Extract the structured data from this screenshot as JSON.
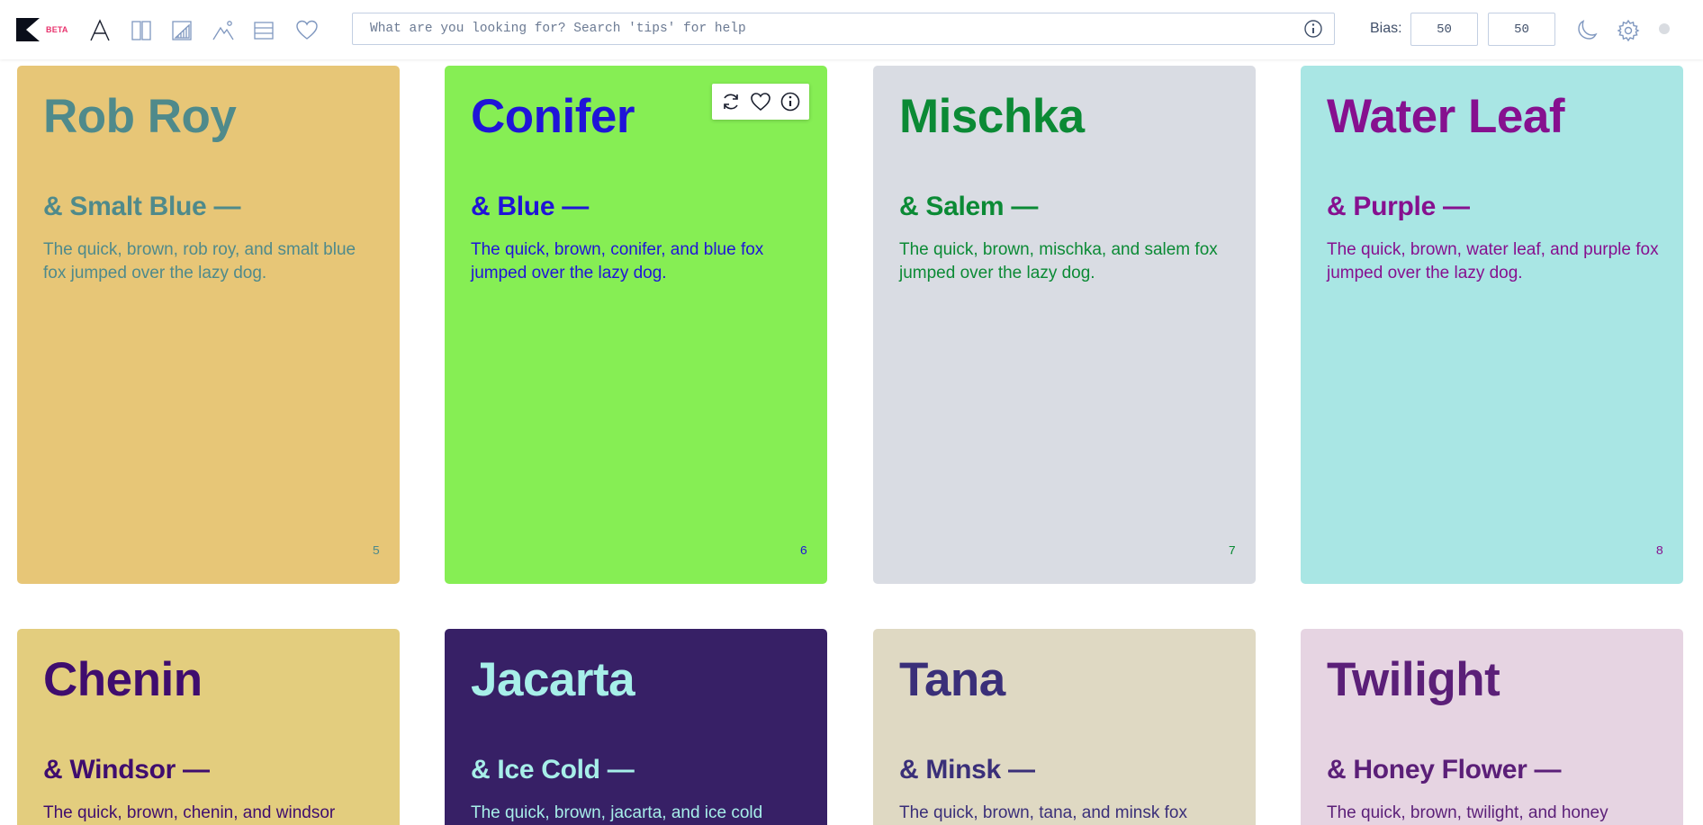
{
  "app": {
    "beta_label": "BETA",
    "toolbar_icons": [
      "typeface-icon",
      "split-columns-icon",
      "chart-panel-icon",
      "image-mountain-icon",
      "list-rows-icon",
      "heart-icon"
    ]
  },
  "search": {
    "placeholder": "What are you looking for? Search 'tips' for help",
    "value": ""
  },
  "bias": {
    "label": "Bias:",
    "value_1": "50",
    "value_2": "50"
  },
  "colors": {
    "accent": "#e8336d",
    "icon": "#7f97bf"
  },
  "cards": [
    {
      "number": "5",
      "name": "Rob Roy",
      "pair": "& Smalt Blue —",
      "sentence": "The quick, brown, rob roy, and smalt blue fox jumped over the lazy dog.",
      "bg": "#e7c677",
      "fg": "#4f8a8b"
    },
    {
      "number": "6",
      "name": "Conifer",
      "pair": "& Blue —",
      "sentence": "The quick, brown, conifer, and blue fox jumped over the lazy dog.",
      "bg": "#86ee54",
      "fg": "#1f14d8",
      "hover_tools": [
        "refresh-icon",
        "heart-icon",
        "info-icon"
      ]
    },
    {
      "number": "7",
      "name": "Mischka",
      "pair": "& Salem —",
      "sentence": "The quick, brown, mischka, and salem fox jumped over the lazy dog.",
      "bg": "#d9dce3",
      "fg": "#0b8a35"
    },
    {
      "number": "8",
      "name": "Water Leaf",
      "pair": "& Purple —",
      "sentence": "The quick, brown, water leaf, and purple fox jumped over the lazy dog.",
      "bg": "#a9e6e4",
      "fg": "#86108f"
    },
    {
      "number": "",
      "name": "Chenin",
      "pair": "& Windsor —",
      "sentence": "The quick, brown, chenin, and windsor",
      "bg": "#e3cd7e",
      "fg": "#3f0d6e"
    },
    {
      "number": "",
      "name": "Jacarta",
      "pair": "& Ice Cold —",
      "sentence": "The quick, brown, jacarta, and ice cold",
      "bg": "#372066",
      "fg": "#a7efe9"
    },
    {
      "number": "",
      "name": "Tana",
      "pair": "& Minsk —",
      "sentence": "The quick, brown, tana, and minsk fox",
      "bg": "#dfd9c3",
      "fg": "#3a2f79"
    },
    {
      "number": "",
      "name": "Twilight",
      "pair": "& Honey Flower —",
      "sentence": "The quick, brown, twilight, and honey",
      "bg": "#e6d4e2",
      "fg": "#5b1f78"
    }
  ]
}
